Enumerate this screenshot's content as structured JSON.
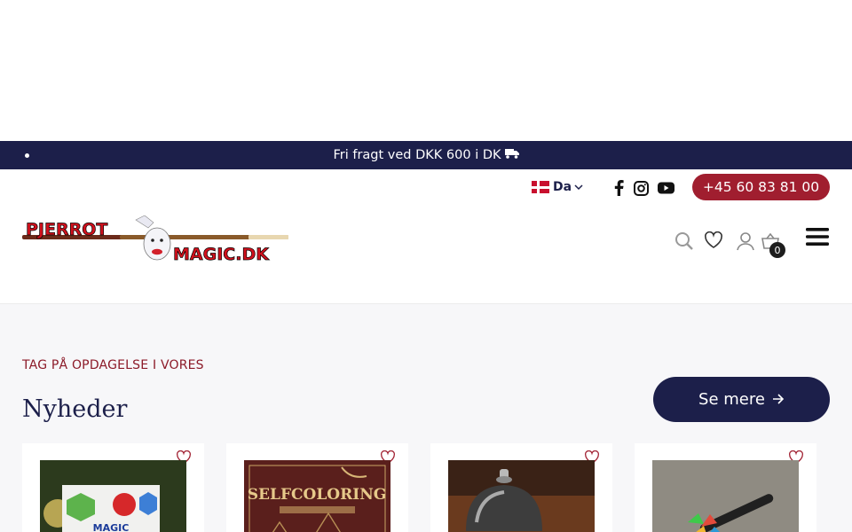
{
  "announcement": {
    "text": "Fri fragt ved DKK 600 i DK"
  },
  "header": {
    "language": {
      "code": "Da",
      "flag": "denmark-flag"
    },
    "socials": [
      "facebook-icon",
      "instagram-icon",
      "youtube-icon"
    ],
    "phone": "+45 60 83 81 00",
    "logo": {
      "line1": "PJERROT",
      "line2": "MAGIC.DK"
    },
    "cart_count": "0"
  },
  "section": {
    "eyebrow": "TAG PÅ OPDAGELSE I VORES",
    "title": "Nyheder",
    "button_label": "Se mere"
  },
  "products": [
    {
      "name": "magic-cube-product",
      "image_text": "MAGIC"
    },
    {
      "name": "harry-potter-coloring-book",
      "image_text": "SELFCOLORING"
    },
    {
      "name": "service-bell-product",
      "image_text": ""
    },
    {
      "name": "sharpie-feather-product",
      "image_text": ""
    }
  ],
  "colors": {
    "navy": "#1c1f4a",
    "accent": "#a01e2f",
    "eyebrow": "#8c1a28"
  }
}
